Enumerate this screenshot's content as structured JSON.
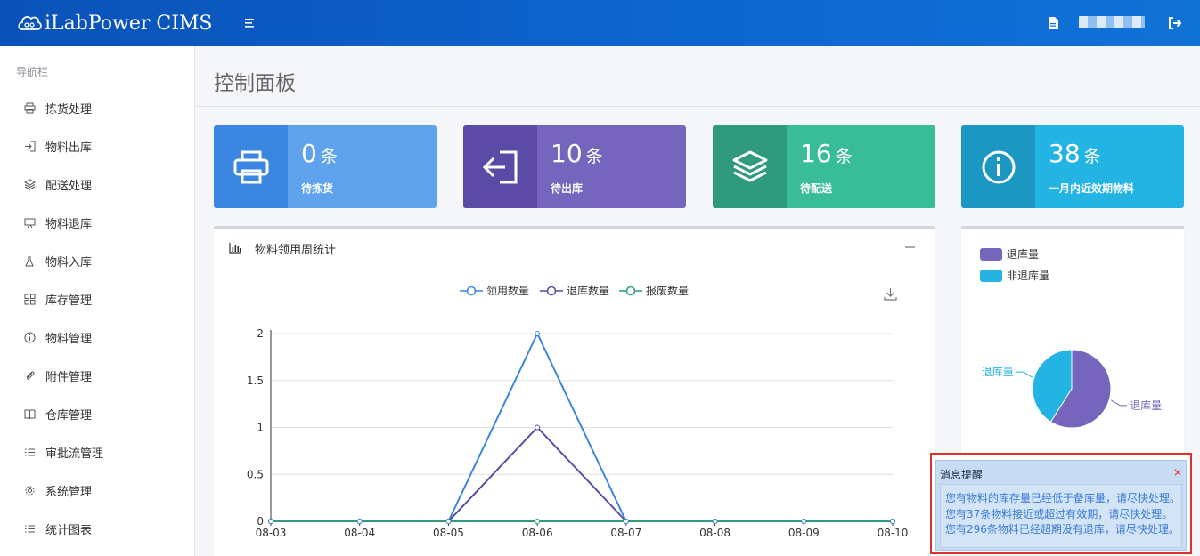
{
  "app": {
    "logo_text": "iLabPower CIMS"
  },
  "sidebar": {
    "title": "导航栏",
    "items": [
      {
        "label": "拣货处理",
        "icon": "printer-icon"
      },
      {
        "label": "物料出库",
        "icon": "sign-out-icon"
      },
      {
        "label": "配送处理",
        "icon": "layers-icon"
      },
      {
        "label": "物料退库",
        "icon": "monitor-icon"
      },
      {
        "label": "物料入库",
        "icon": "flask-icon"
      },
      {
        "label": "库存管理",
        "icon": "grid-icon"
      },
      {
        "label": "物料管理",
        "icon": "info-icon"
      },
      {
        "label": "附件管理",
        "icon": "paperclip-icon"
      },
      {
        "label": "仓库管理",
        "icon": "book-icon"
      },
      {
        "label": "审批流管理",
        "icon": "list-icon"
      },
      {
        "label": "系统管理",
        "icon": "gear-icon"
      },
      {
        "label": "统计图表",
        "icon": "list-icon"
      }
    ]
  },
  "page": {
    "title": "控制面板"
  },
  "cards": [
    {
      "value": "0",
      "unit": "条",
      "label": "待拣货",
      "color_icon": "#3a86e0",
      "color_body": "#5ea3ec",
      "icon": "printer-icon"
    },
    {
      "value": "10",
      "unit": "条",
      "label": "待出库",
      "color_icon": "#5c4ba6",
      "color_body": "#7565bd",
      "icon": "sign-out-icon"
    },
    {
      "value": "16",
      "unit": "条",
      "label": "待配送",
      "color_icon": "#2f9a7d",
      "color_body": "#39bd99",
      "icon": "layers-icon"
    },
    {
      "value": "38",
      "unit": "条",
      "label": "一月内近效期物料",
      "color_icon": "#1b97c2",
      "color_body": "#23b4e4",
      "icon": "info-icon"
    }
  ],
  "weekly_panel": {
    "title": "物料领用周统计",
    "legend": [
      "领用数量",
      "退库数量",
      "报废数量"
    ]
  },
  "chart_data": [
    {
      "type": "line",
      "x": [
        "08-03",
        "08-04",
        "08-05",
        "08-06",
        "08-07",
        "08-08",
        "08-09",
        "08-10"
      ],
      "series": [
        {
          "name": "领用数量",
          "values": [
            0,
            0,
            0,
            2,
            0,
            0,
            0,
            0
          ],
          "color": "#3a86e0"
        },
        {
          "name": "退库数量",
          "values": [
            0,
            0,
            0,
            1,
            0,
            0,
            0,
            0
          ],
          "color": "#5c4ba6"
        },
        {
          "name": "报废数量",
          "values": [
            0,
            0,
            0,
            0,
            0,
            0,
            0,
            0
          ],
          "color": "#2f9a7d"
        }
      ],
      "yticks": [
        "0",
        "0.5",
        "1",
        "1.5",
        "2"
      ],
      "ylim": [
        0,
        2
      ],
      "grid": true,
      "legend_position": "top"
    },
    {
      "type": "pie",
      "categories": [
        "退库量",
        "非退库量"
      ],
      "values": [
        59,
        41
      ],
      "colors": [
        "#7565bd",
        "#23b4e4"
      ],
      "legend_position": "top-left"
    }
  ],
  "notification": {
    "title": "消息提醒",
    "close": "×",
    "lines": [
      "您有物料的库存量已经低于备库量，请尽快处理。",
      "您有37条物料接近或超过有效期，请尽快处理。",
      "您有296条物料已经超期没有退库，请尽快处理。"
    ]
  }
}
